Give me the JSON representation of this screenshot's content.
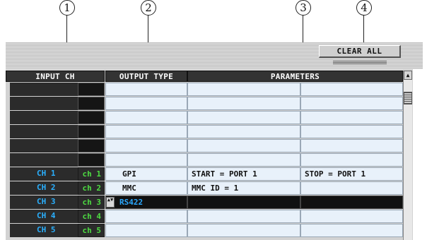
{
  "callouts": [
    "1",
    "2",
    "3",
    "4"
  ],
  "clear_all_label": "CLEAR ALL",
  "headers": {
    "input_ch": "INPUT CH",
    "output_type": "OUTPUT TYPE",
    "parameters": "PARAMETERS"
  },
  "scroll_up_glyph": "▲",
  "spin_glyph": "▲▼",
  "rows": [
    {
      "name": "",
      "ch": "",
      "type": "",
      "p1": "",
      "p2": ""
    },
    {
      "name": "",
      "ch": "",
      "type": "",
      "p1": "",
      "p2": ""
    },
    {
      "name": "",
      "ch": "",
      "type": "",
      "p1": "",
      "p2": ""
    },
    {
      "name": "",
      "ch": "",
      "type": "",
      "p1": "",
      "p2": ""
    },
    {
      "name": "",
      "ch": "",
      "type": "",
      "p1": "",
      "p2": ""
    },
    {
      "name": "",
      "ch": "",
      "type": "",
      "p1": "",
      "p2": ""
    },
    {
      "name": "CH 1",
      "ch": "ch 1",
      "type": "GPI",
      "p1": "START = PORT 1",
      "p2": "STOP = PORT 1"
    },
    {
      "name": "CH 2",
      "ch": "ch 2",
      "type": "MMC",
      "p1": "MMC ID =   1",
      "p2": ""
    },
    {
      "name": "CH 3",
      "ch": "ch 3",
      "type": "RS422",
      "p1": "",
      "p2": ""
    },
    {
      "name": "CH 4",
      "ch": "ch 4",
      "type": "",
      "p1": "",
      "p2": ""
    },
    {
      "name": "CH 5",
      "ch": "ch 5",
      "type": "",
      "p1": "",
      "p2": ""
    }
  ]
}
